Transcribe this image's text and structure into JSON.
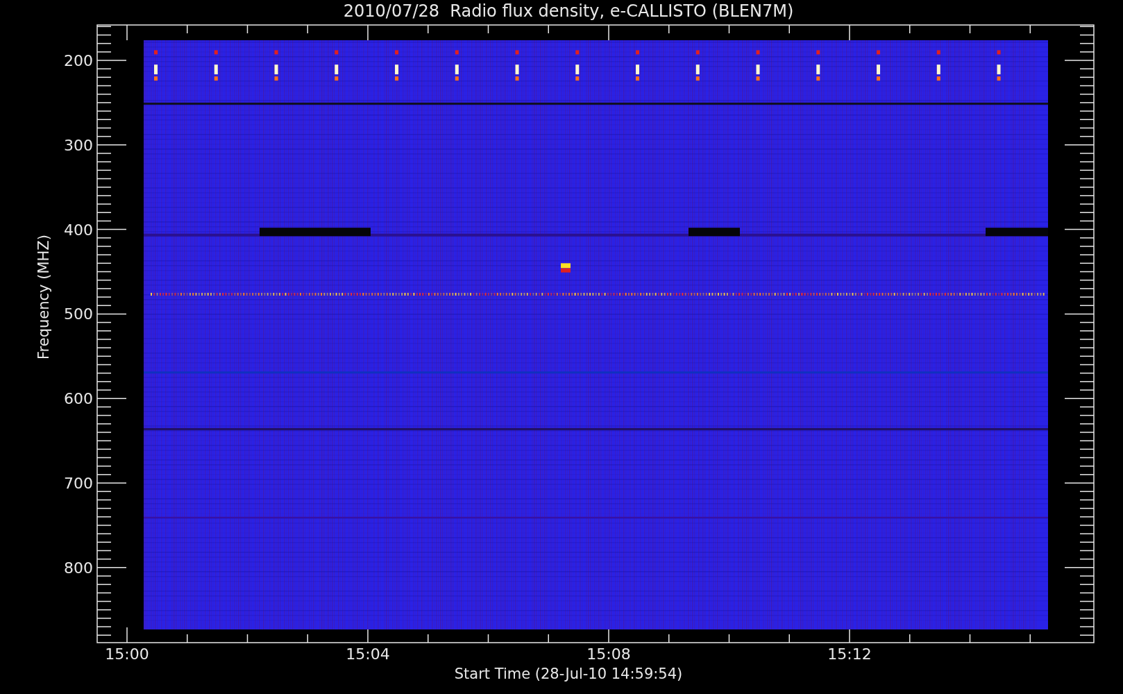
{
  "title": "2010/07/28  Radio flux density, e-CALLISTO (BLEN7M)",
  "y_axis": {
    "label": "Frequency (MHZ)",
    "ticks": [
      "200",
      "300",
      "400",
      "500",
      "600",
      "700",
      "800"
    ]
  },
  "x_axis": {
    "label": "Start Time (28-Jul-10 14:59:54)",
    "ticks": [
      "15:00",
      "15:04",
      "15:08",
      "15:12"
    ]
  }
}
